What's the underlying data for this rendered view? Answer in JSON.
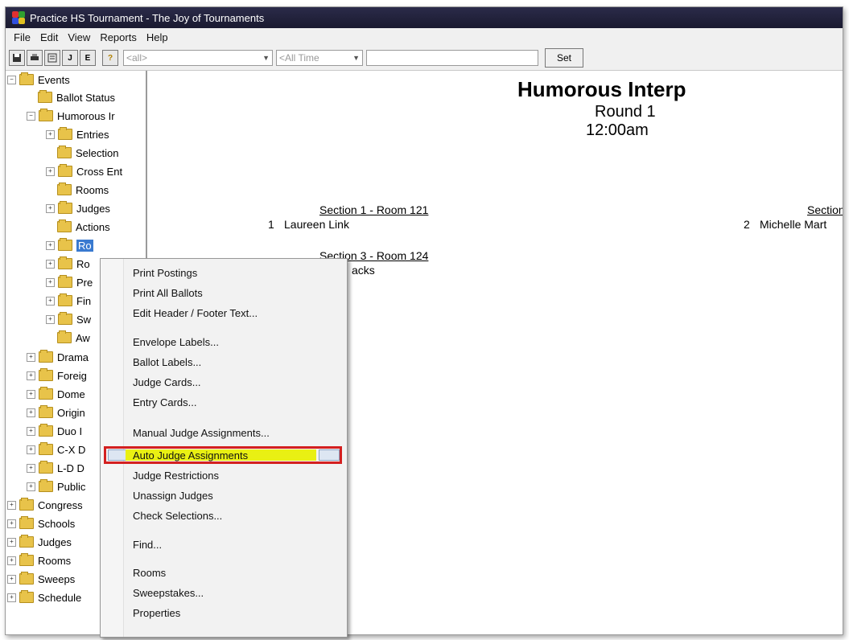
{
  "window": {
    "title": "Practice HS Tournament - The Joy of Tournaments"
  },
  "menu": [
    "File",
    "Edit",
    "View",
    "Reports",
    "Help"
  ],
  "toolbar": {
    "buttons": [
      "save-icon",
      "print-icon",
      "preview-icon",
      "J",
      "E",
      "help-icon"
    ],
    "combo1": "<all>",
    "combo2": "<All Time",
    "set_label": "Set"
  },
  "tree": {
    "events": "Events",
    "ballot_status": "Ballot Status",
    "humorous": "Humorous Ir",
    "entries": "Entries",
    "selection": "Selection",
    "cross_ent": "Cross Ent",
    "rooms_sub": "Rooms",
    "judges_sub": "Judges",
    "actions": "Actions",
    "ro_selected": "Ro",
    "ro2": "Ro",
    "pre": "Pre",
    "fin": "Fin",
    "sw": "Sw",
    "aw": "Aw",
    "drama": "Drama",
    "foreign": "Foreig",
    "dome": "Dome",
    "origin": "Origin",
    "duo": "Duo I",
    "cx": "C-X D",
    "ld": "L-D D",
    "public": "Public",
    "congress": "Congress",
    "schools": "Schools",
    "judges": "Judges",
    "rooms": "Rooms",
    "sweeps": "Sweeps",
    "schedule": "Schedule"
  },
  "document": {
    "title": "Humorous Interp",
    "round": "Round 1",
    "time": "12:00am",
    "section1_header": "Section 1 - Room 121",
    "section1_num": "1",
    "section1_name": "Laureen Link",
    "section2_header": "Section",
    "section2_num": "2",
    "section2_name": "Michelle Mart",
    "section3_header": "Section 3 - Room 124",
    "section3_name": "acks"
  },
  "context_menu": {
    "print_postings": "Print Postings",
    "print_all_ballots": "Print All Ballots",
    "edit_header_footer": "Edit Header / Footer Text...",
    "envelope_labels": "Envelope Labels...",
    "ballot_labels": "Ballot Labels...",
    "judge_cards": "Judge Cards...",
    "entry_cards": "Entry Cards...",
    "manual_judge": "Manual Judge Assignments...",
    "auto_judge": "Auto Judge Assignments",
    "judge_restrictions": "Judge Restrictions",
    "unassign_judges": "Unassign Judges",
    "check_selections": "Check Selections...",
    "find": "Find...",
    "rooms": "Rooms",
    "sweepstakes": "Sweepstakes...",
    "properties": "Properties"
  },
  "colors": {
    "highlight_border": "#d32020",
    "highlight_fill": "#e9f013",
    "selection": "#3a7ad0"
  }
}
